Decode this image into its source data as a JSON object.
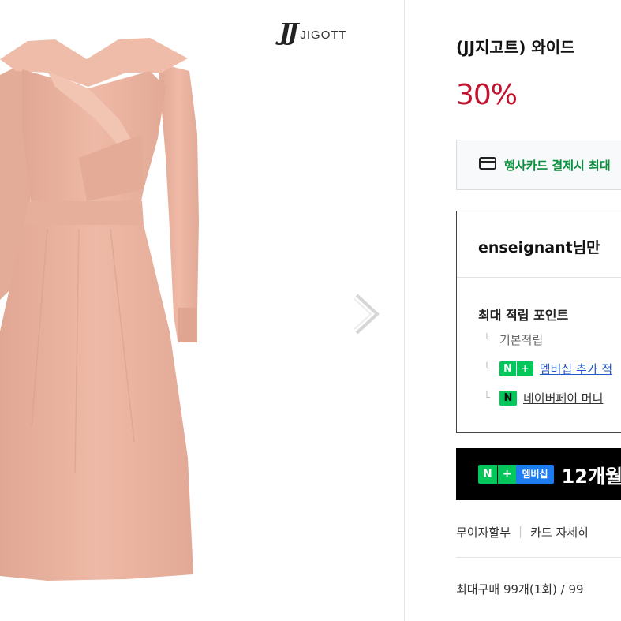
{
  "brand": {
    "mark": "JJ",
    "name": "JIGOTT"
  },
  "product": {
    "title": "(JJ지고트) 와이드",
    "discount": "30%"
  },
  "card_promo": {
    "icon": "credit-card-icon",
    "text": "행사카드 결제시 최대"
  },
  "points": {
    "user_line": "enseignant님만",
    "title": "최대 적립 포인트",
    "rows": [
      {
        "label": "기본적립"
      },
      {
        "badge": "N+",
        "label": "멤버십 추가 적"
      },
      {
        "badge": "N pay",
        "label": "네이버페이 머니"
      }
    ]
  },
  "membership_banner": {
    "badge_n": "N",
    "badge_plus": "+",
    "badge_label": "멤버십",
    "text": "12개월"
  },
  "installment": {
    "left": "무이자할부",
    "right": "카드 자세히"
  },
  "max_purchase": "최대구매 99개(1회) / 99",
  "colors": {
    "discount": "#c3122f",
    "promo_green": "#0a8f3c",
    "naver_green": "#03c75a",
    "dress": "#e9b4a0"
  }
}
